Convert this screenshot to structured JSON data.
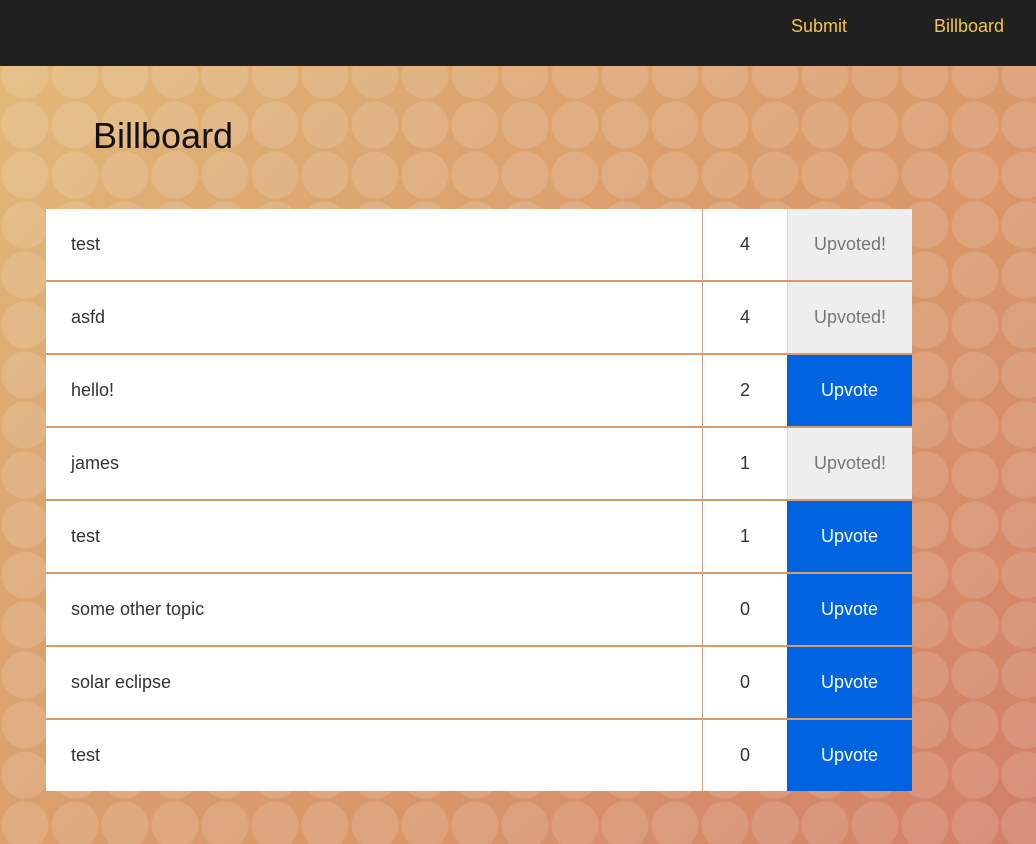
{
  "nav": {
    "submit_label": "Submit",
    "billboard_label": "Billboard"
  },
  "page": {
    "title": "Billboard"
  },
  "colors": {
    "nav_background": "#202020",
    "nav_link": "#f0c452",
    "upvote_button": "#0064e1",
    "upvoted_button": "#eeeeee"
  },
  "topics": [
    {
      "title": "test",
      "votes": "4",
      "action": "Upvoted!",
      "upvoted": true
    },
    {
      "title": "asfd",
      "votes": "4",
      "action": "Upvoted!",
      "upvoted": true
    },
    {
      "title": "hello!",
      "votes": "2",
      "action": "Upvote",
      "upvoted": false
    },
    {
      "title": "james",
      "votes": "1",
      "action": "Upvoted!",
      "upvoted": true
    },
    {
      "title": "test",
      "votes": "1",
      "action": "Upvote",
      "upvoted": false
    },
    {
      "title": "some other topic",
      "votes": "0",
      "action": "Upvote",
      "upvoted": false
    },
    {
      "title": "solar eclipse",
      "votes": "0",
      "action": "Upvote",
      "upvoted": false
    },
    {
      "title": "test",
      "votes": "0",
      "action": "Upvote",
      "upvoted": false
    }
  ]
}
